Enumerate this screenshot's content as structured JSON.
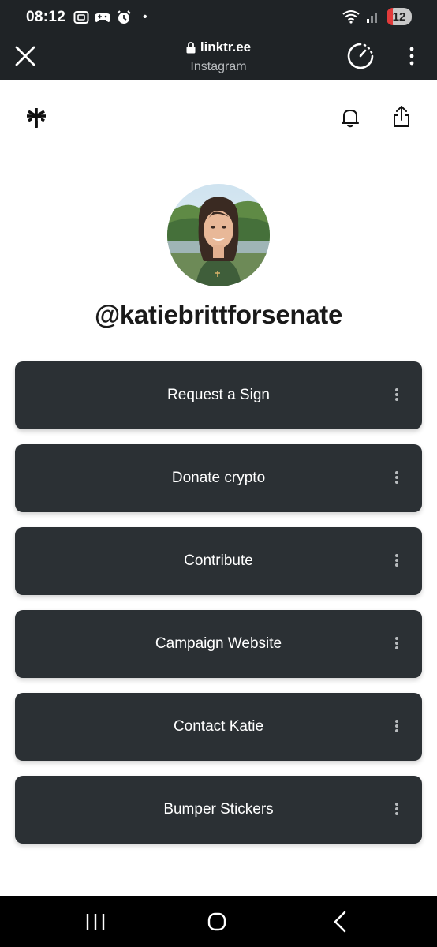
{
  "status_bar": {
    "time": "08:12",
    "notification_dot": "•",
    "battery_level": "12",
    "icons": [
      "screenshot-icon",
      "game-controller-icon",
      "alarm-icon",
      "wifi-icon",
      "signal-icon"
    ]
  },
  "browser": {
    "domain": "linktr.ee",
    "source": "Instagram",
    "icons": [
      "close-icon",
      "lock-icon",
      "speed-dial-icon",
      "more-vertical-icon"
    ]
  },
  "profile": {
    "username": "@katiebrittforsenate",
    "header_icons": [
      "linktree-logo-icon",
      "bell-icon",
      "share-icon"
    ]
  },
  "links": [
    {
      "label": "Request a Sign"
    },
    {
      "label": "Donate crypto"
    },
    {
      "label": "Contribute"
    },
    {
      "label": "Campaign Website"
    },
    {
      "label": "Contact Katie"
    },
    {
      "label": "Bumper Stickers"
    }
  ],
  "colors": {
    "browser_bar": "#1f2326",
    "link_button": "#2b3034",
    "link_text": "#ffffff",
    "page_background": "#ffffff",
    "nav_bar": "#000000"
  },
  "nav_bar": {
    "icons": [
      "recent-apps-icon",
      "home-icon",
      "back-icon"
    ]
  }
}
